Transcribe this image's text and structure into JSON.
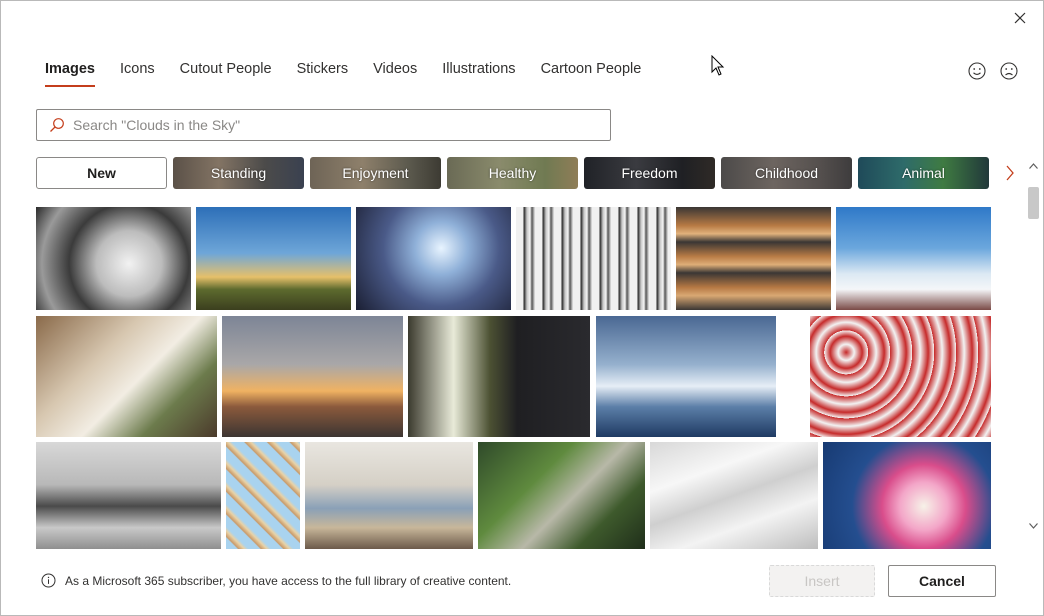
{
  "tabs": [
    {
      "label": "Images",
      "active": true
    },
    {
      "label": "Icons",
      "active": false
    },
    {
      "label": "Cutout People",
      "active": false
    },
    {
      "label": "Stickers",
      "active": false
    },
    {
      "label": "Videos",
      "active": false
    },
    {
      "label": "Illustrations",
      "active": false
    },
    {
      "label": "Cartoon People",
      "active": false
    }
  ],
  "search": {
    "placeholder": "Search \"Clouds in the Sky\"",
    "value": ""
  },
  "categories": [
    {
      "label": "New",
      "selected": true
    },
    {
      "label": "Standing",
      "selected": false
    },
    {
      "label": "Enjoyment",
      "selected": false
    },
    {
      "label": "Healthy",
      "selected": false
    },
    {
      "label": "Freedom",
      "selected": false
    },
    {
      "label": "Childhood",
      "selected": false
    },
    {
      "label": "Animal",
      "selected": false
    }
  ],
  "images": [
    {
      "subject": "spiral staircase"
    },
    {
      "subject": "desert cactus"
    },
    {
      "subject": "concert crowd heart hands"
    },
    {
      "subject": "birch trees"
    },
    {
      "subject": "baguettes on tray"
    },
    {
      "subject": "bridge above clouds"
    },
    {
      "subject": "wedding table"
    },
    {
      "subject": "woman at sunset"
    },
    {
      "subject": "hands and flowers"
    },
    {
      "subject": "icy sea"
    },
    {
      "subject": "beach umbrellas"
    },
    {
      "subject": "balancing spheres"
    },
    {
      "subject": "pattern of bottles"
    },
    {
      "subject": "woman working at desk"
    },
    {
      "subject": "watering plants"
    },
    {
      "subject": "open book pages"
    },
    {
      "subject": "frangipani flowers"
    }
  ],
  "footer": {
    "info_text": "As a Microsoft 365 subscriber, you have access to the full library of creative content.",
    "insert_label": "Insert",
    "cancel_label": "Cancel"
  },
  "icons": {
    "close": "close-icon",
    "smile": "smile-icon",
    "frown": "frown-icon",
    "search": "search-icon",
    "next": "chevron-right-icon",
    "info": "info-icon"
  }
}
